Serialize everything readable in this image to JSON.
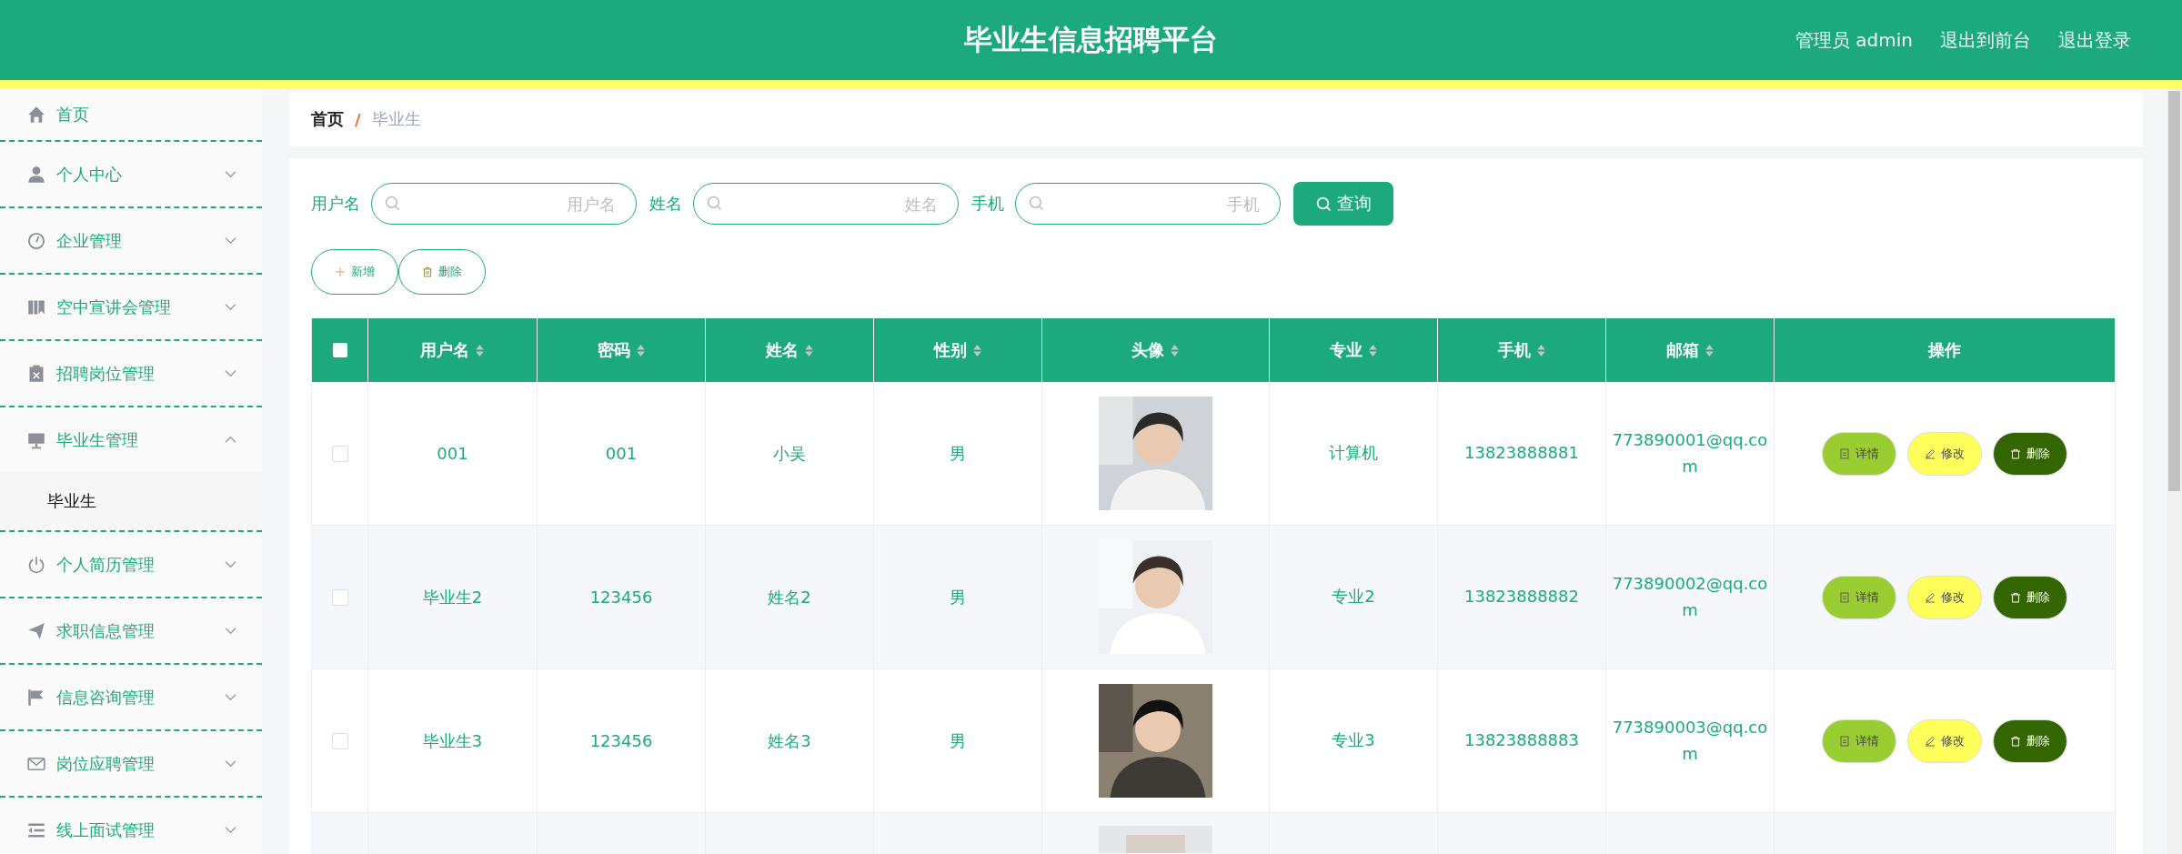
{
  "header": {
    "title": "毕业生信息招聘平台",
    "links": [
      "管理员 admin",
      "退出到前台",
      "退出登录"
    ]
  },
  "sidebar": {
    "items": [
      {
        "label": "首页"
      },
      {
        "label": "个人中心",
        "expanded": false
      },
      {
        "label": "企业管理",
        "expanded": false
      },
      {
        "label": "空中宣讲会管理",
        "expanded": false
      },
      {
        "label": "招聘岗位管理",
        "expanded": false
      },
      {
        "label": "毕业生管理",
        "expanded": true,
        "children": [
          {
            "label": "毕业生",
            "selected": true
          }
        ]
      },
      {
        "label": "个人简历管理",
        "expanded": false
      },
      {
        "label": "求职信息管理",
        "expanded": false
      },
      {
        "label": "信息咨询管理",
        "expanded": false
      },
      {
        "label": "岗位应聘管理",
        "expanded": false
      },
      {
        "label": "线上面试管理",
        "expanded": false
      }
    ]
  },
  "breadcrumb": {
    "items": [
      "首页",
      "毕业生"
    ],
    "separator": "/"
  },
  "search": {
    "fields": [
      {
        "label": "用户名",
        "placeholder": "用户名"
      },
      {
        "label": "姓名",
        "placeholder": "姓名"
      },
      {
        "label": "手机",
        "placeholder": "手机"
      }
    ],
    "button": "查询"
  },
  "actions": [
    {
      "label": "新增",
      "kind": "add"
    },
    {
      "label": "删除",
      "kind": "delete"
    }
  ],
  "table": {
    "all_checked": false,
    "columns": [
      "用户名",
      "密码",
      "姓名",
      "性别",
      "头像",
      "专业",
      "手机",
      "邮箱",
      "操作"
    ],
    "rows": [
      {
        "checked": false,
        "username": "001",
        "password": "001",
        "name": "小吴",
        "gender": "男",
        "avatar": {
          "kind": "picture"
        },
        "major": "计算机",
        "phone": "13823888881",
        "email": "773890001@qq.co\nm",
        "buttons": [
          {
            "label": "详情",
            "kind": "detail"
          },
          {
            "label": "修改",
            "kind": "edit"
          },
          {
            "label": "删除",
            "kind": "delete"
          }
        ]
      },
      {
        "checked": false,
        "username": "毕业生2",
        "password": "123456",
        "name": "姓名2",
        "gender": "男",
        "avatar": {
          "kind": "picture"
        },
        "major": "专业2",
        "phone": "13823888882",
        "email": "773890002@qq.co\nm",
        "buttons": [
          {
            "label": "详情",
            "kind": "detail"
          },
          {
            "label": "修改",
            "kind": "edit"
          },
          {
            "label": "删除",
            "kind": "delete"
          }
        ]
      },
      {
        "checked": false,
        "username": "毕业生3",
        "password": "123456",
        "name": "姓名3",
        "gender": "男",
        "avatar": {
          "kind": "picture"
        },
        "major": "专业3",
        "phone": "13823888883",
        "email": "773890003@qq.co\nm",
        "buttons": [
          {
            "label": "详情",
            "kind": "detail"
          },
          {
            "label": "修改",
            "kind": "edit"
          },
          {
            "label": "删除",
            "kind": "delete"
          }
        ]
      },
      {
        "avatar": {
          "kind": "picture"
        }
      }
    ]
  }
}
